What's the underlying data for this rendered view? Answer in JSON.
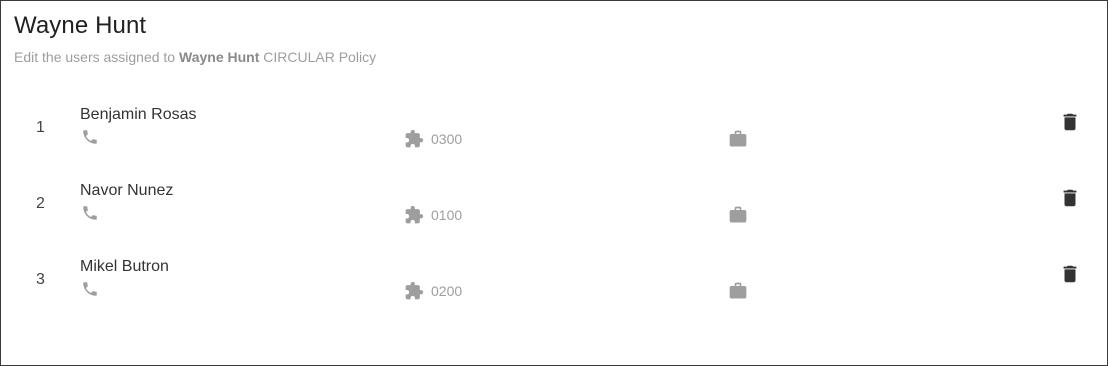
{
  "header": {
    "title": "Wayne Hunt",
    "subtitle_prefix": "Edit the users assigned to ",
    "subtitle_bold": "Wayne Hunt",
    "subtitle_suffix": " CIRCULAR Policy"
  },
  "users": [
    {
      "index": "1",
      "name": "Benjamin Rosas",
      "extension": "0300"
    },
    {
      "index": "2",
      "name": "Navor Nunez",
      "extension": "0100"
    },
    {
      "index": "3",
      "name": "Mikel Butron",
      "extension": "0200"
    }
  ],
  "icons": {
    "phone": "phone-icon",
    "extension": "puzzle-icon",
    "briefcase": "briefcase-icon",
    "delete": "trash-icon"
  },
  "colors": {
    "icon_gray": "#9e9e9e",
    "delete_icon": "#333333",
    "text_primary": "#212121"
  }
}
